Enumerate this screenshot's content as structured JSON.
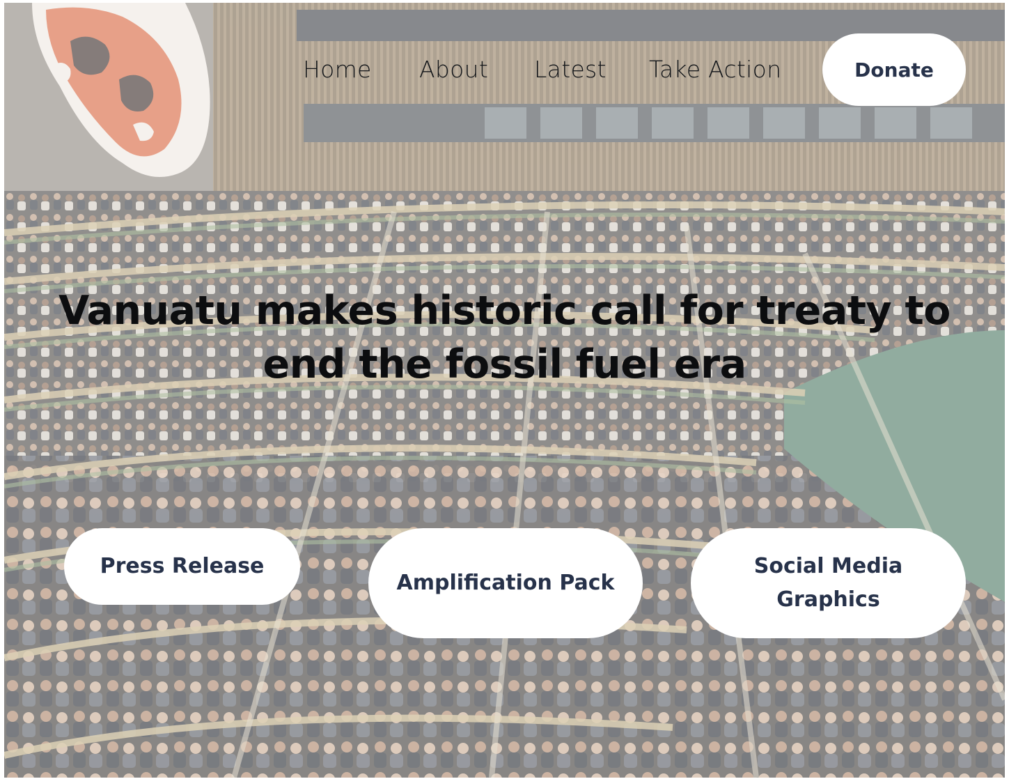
{
  "nav": {
    "links": [
      {
        "label": "Home"
      },
      {
        "label": "About"
      },
      {
        "label": "Latest"
      },
      {
        "label": "Take Action"
      }
    ],
    "donate_label": "Donate"
  },
  "hero": {
    "headline": "Vanuatu makes historic call for treaty to end the fossil fuel era",
    "background": "assembly-hall-photo"
  },
  "actions": [
    {
      "label": "Press Release"
    },
    {
      "label": "Amplification Pack"
    },
    {
      "label": "Social Media Graphics"
    }
  ],
  "colors": {
    "button_bg": "#ffffff",
    "button_text": "#27324a",
    "headline_text": "#0c0d0f",
    "flag_orange": "#d9663f"
  }
}
